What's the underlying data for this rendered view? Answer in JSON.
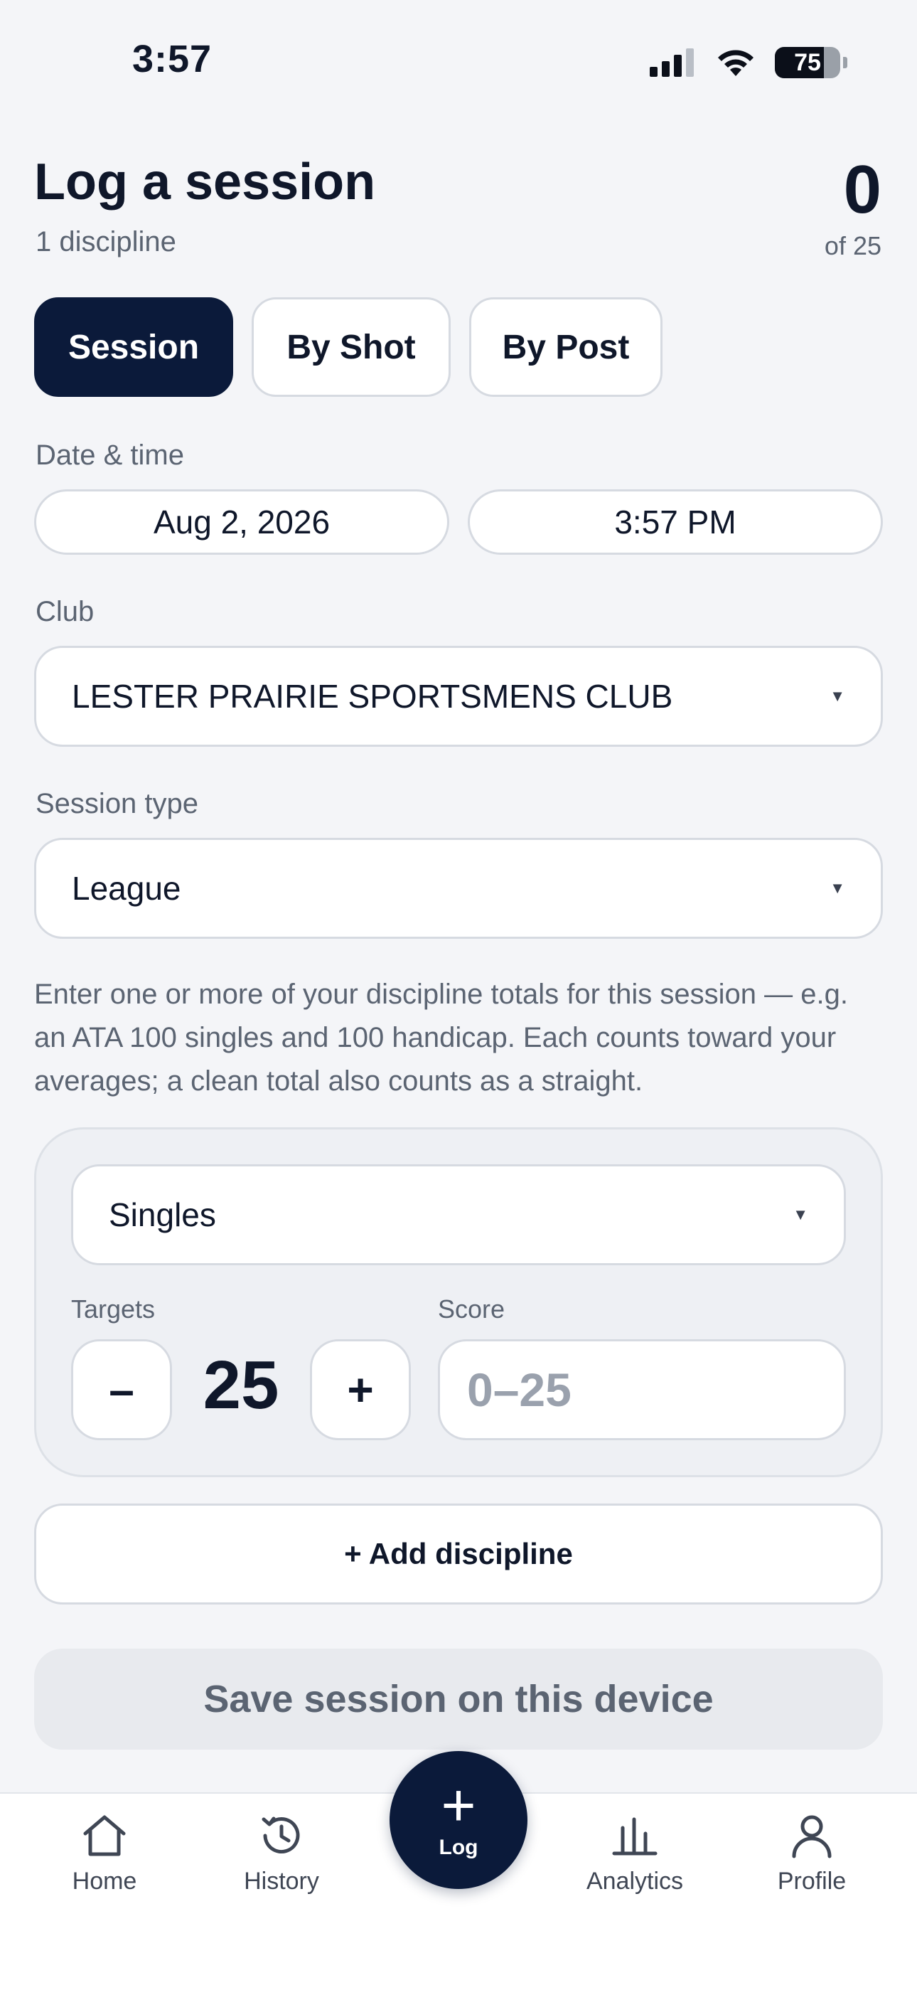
{
  "status_bar": {
    "time": "3:57",
    "battery": "75",
    "battery_level": 0.75
  },
  "header": {
    "title": "Log a session",
    "subtitle": "1 discipline",
    "count": "0",
    "count_of": "of 25"
  },
  "modes": [
    {
      "label": "Session",
      "active": true
    },
    {
      "label": "By Shot",
      "active": false
    },
    {
      "label": "By Post",
      "active": false
    }
  ],
  "date_time": {
    "label": "Date & time",
    "date": "Aug 2, 2026",
    "time": "3:57 PM"
  },
  "club": {
    "label": "Club",
    "value": "LESTER PRAIRIE SPORTSMENS CLUB"
  },
  "session_type": {
    "label": "Session type",
    "value": "League"
  },
  "help_text": "Enter one or more of your discipline totals for this session — e.g. an ATA 100 singles and 100 handicap. Each counts toward your averages; a clean total also counts as a straight.",
  "discipline": {
    "value": "Singles",
    "targets_label": "Targets",
    "targets_value": "25",
    "minus": "–",
    "plus": "+",
    "score_label": "Score",
    "score_placeholder": "0–25"
  },
  "actions": {
    "add_discipline": "+ Add discipline",
    "save": "Save session on this device"
  },
  "tabbar": {
    "home": "Home",
    "history": "History",
    "log": "Log",
    "analytics": "Analytics",
    "profile": "Profile"
  },
  "colors": {
    "primary": "#0b1a3a",
    "muted": "#5b6472",
    "border": "#d6dae1"
  }
}
